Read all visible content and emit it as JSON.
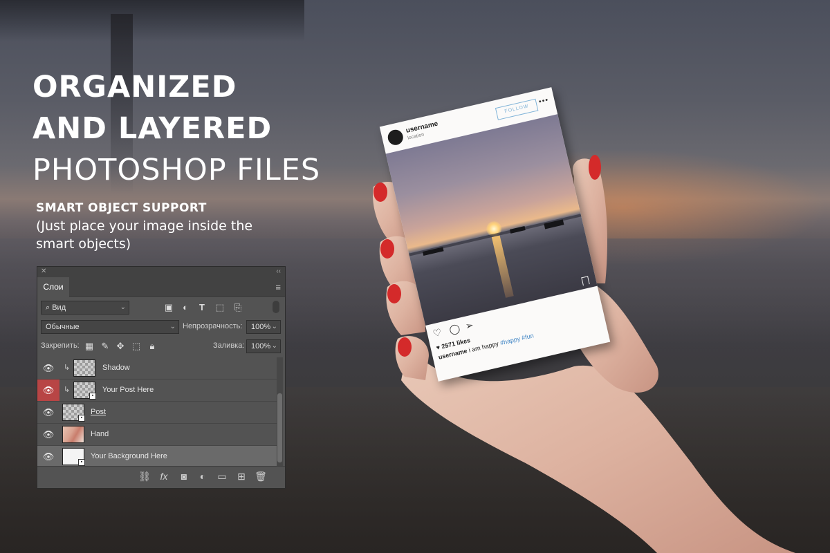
{
  "headline": {
    "line1": "ORGANIZED",
    "line2": "AND LAYERED",
    "line3": "PHOTOSHOP FILES"
  },
  "subhead": {
    "line1": "SMART OBJECT SUPPORT",
    "line2": "(Just place your image inside the smart objects)"
  },
  "layers_panel": {
    "tab_label": "Слои",
    "filter_label": "Вид",
    "blend_mode": "Обычные",
    "opacity_label": "Непрозрачность:",
    "opacity_value": "100%",
    "lock_label": "Закрепить:",
    "fill_label": "Заливка:",
    "fill_value": "100%",
    "layers": [
      {
        "name": "Shadow",
        "selected": false
      },
      {
        "name": "Your Post Here",
        "selected": false
      },
      {
        "name": "Post",
        "selected": false
      },
      {
        "name": "Hand",
        "selected": false
      },
      {
        "name": "Your Background Here",
        "selected": true
      }
    ]
  },
  "post_card": {
    "username": "username",
    "location": "location",
    "follow_label": "FOLLOW",
    "more_label": "•••",
    "likes": "♥ 2571 likes",
    "caption_user": "username",
    "caption_text": " i am happy ",
    "caption_tags": "#happy #fun"
  },
  "colors": {
    "panel_bg": "#535353",
    "eye_highlight": "#b84545",
    "accent_blue": "#3b82c4",
    "follow_border": "#7fb3d8"
  },
  "icons": {
    "close": "close-icon",
    "collapse": "double-chevron-icon",
    "panel_menu": "hamburger-menu-icon",
    "filter_search": "search-icon",
    "filter_pixel": "image-filter-icon",
    "filter_adjust": "adjustment-filter-icon",
    "filter_type": "type-filter-icon",
    "filter_shape": "shape-filter-icon",
    "filter_smart": "smart-object-filter-icon",
    "lock_transparent": "lock-transparency-icon",
    "lock_brush": "lock-paint-icon",
    "lock_move": "lock-position-icon",
    "lock_artboard": "lock-artboard-icon",
    "lock_all": "lock-all-icon",
    "visibility": "eye-icon",
    "link": "link-layers-icon",
    "fx": "layer-style-icon",
    "mask": "add-mask-icon",
    "adjust": "adjustment-layer-icon",
    "group": "folder-icon",
    "new_layer": "new-layer-icon",
    "delete": "trash-icon",
    "like": "heart-icon",
    "comment": "comment-icon",
    "share": "send-icon",
    "bookmark": "bookmark-icon"
  }
}
